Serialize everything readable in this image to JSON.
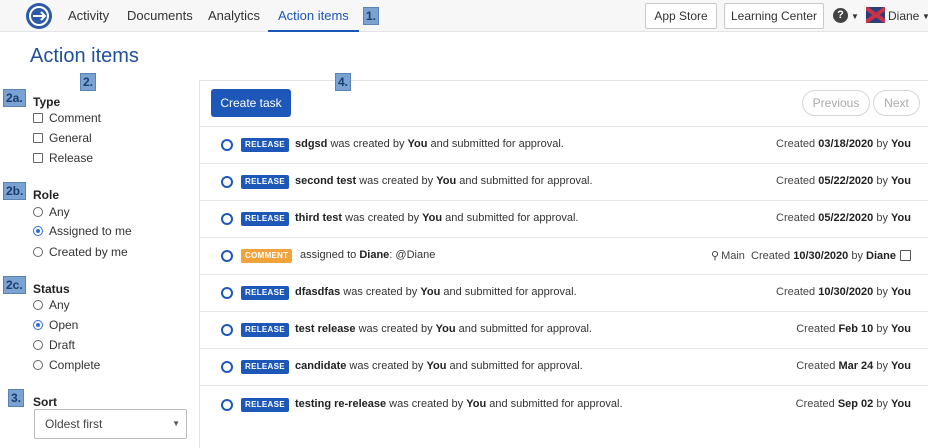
{
  "nav": {
    "tabs": [
      {
        "label": "Activity"
      },
      {
        "label": "Documents"
      },
      {
        "label": "Analytics"
      },
      {
        "label": "Action items"
      }
    ],
    "app_store": "App Store",
    "learning_center": "Learning Center",
    "help_glyph": "?",
    "user_name": "Diane",
    "icons": {
      "logo": "onshape-logo-icon",
      "help": "help-icon",
      "flag": "uk-flag-avatar"
    }
  },
  "callouts": {
    "c1": "1.",
    "c2": "2.",
    "c2a": "2a.",
    "c2b": "2b.",
    "c2c": "2c.",
    "c3": "3.",
    "c4": "4."
  },
  "page_title": "Action items",
  "filters": {
    "type": {
      "heading": "Type",
      "options": [
        "Comment",
        "General",
        "Release"
      ]
    },
    "role": {
      "heading": "Role",
      "options": [
        "Any",
        "Assigned to me",
        "Created by me"
      ],
      "selected": "Assigned to me"
    },
    "status": {
      "heading": "Status",
      "options": [
        "Any",
        "Open",
        "Draft",
        "Complete"
      ],
      "selected": "Open"
    },
    "sort": {
      "heading": "Sort",
      "value": "Oldest first"
    }
  },
  "toolbar": {
    "create": "Create task",
    "previous": "Previous",
    "next": "Next"
  },
  "items": [
    {
      "badge": "RELEASE",
      "name": "sdgsd",
      "mid": " was created by ",
      "who": "You",
      "tail": " and submitted for approval.",
      "created_prefix": "Created ",
      "date": "03/18/2020",
      "by": " by ",
      "author": "You"
    },
    {
      "badge": "RELEASE",
      "name": "second test",
      "mid": " was created by ",
      "who": "You",
      "tail": " and submitted for approval.",
      "created_prefix": "Created ",
      "date": "05/22/2020",
      "by": " by ",
      "author": "You"
    },
    {
      "badge": "RELEASE",
      "name": "third test",
      "mid": " was created by ",
      "who": "You",
      "tail": " and submitted for approval.",
      "created_prefix": "Created ",
      "date": "05/22/2020",
      "by": " by ",
      "author": "You"
    },
    {
      "badge": "COMMENT",
      "name": "",
      "mid": "assigned to ",
      "who": "Diane",
      "tail": ":  @Diane",
      "branch": "Main",
      "created_prefix": "Created ",
      "date": "10/30/2020",
      "by": " by ",
      "author": "Diane"
    },
    {
      "badge": "RELEASE",
      "name": "dfasdfas",
      "mid": " was created by ",
      "who": "You",
      "tail": " and submitted for approval.",
      "created_prefix": "Created ",
      "date": "10/30/2020",
      "by": " by ",
      "author": "You"
    },
    {
      "badge": "RELEASE",
      "name": "test release",
      "mid": " was created by ",
      "who": "You",
      "tail": " and submitted for approval.",
      "created_prefix": "Created ",
      "date": "Feb 10",
      "by": " by ",
      "author": "You"
    },
    {
      "badge": "RELEASE",
      "name": "candidate",
      "mid": " was created by ",
      "who": "You",
      "tail": " and submitted for approval.",
      "created_prefix": "Created ",
      "date": "Mar 24",
      "by": " by ",
      "author": "You"
    },
    {
      "badge": "RELEASE",
      "name": "testing re-release",
      "mid": " was created by ",
      "who": "You",
      "tail": " and submitted for approval.",
      "created_prefix": "Created ",
      "date": "Sep 02",
      "by": " by ",
      "author": "You"
    }
  ],
  "colors": {
    "accent": "#1d58b8",
    "release_badge": "#1d58b8",
    "comment_badge": "#f0a23b",
    "title": "#1f4f9a",
    "callout": "#7aa3d1"
  }
}
